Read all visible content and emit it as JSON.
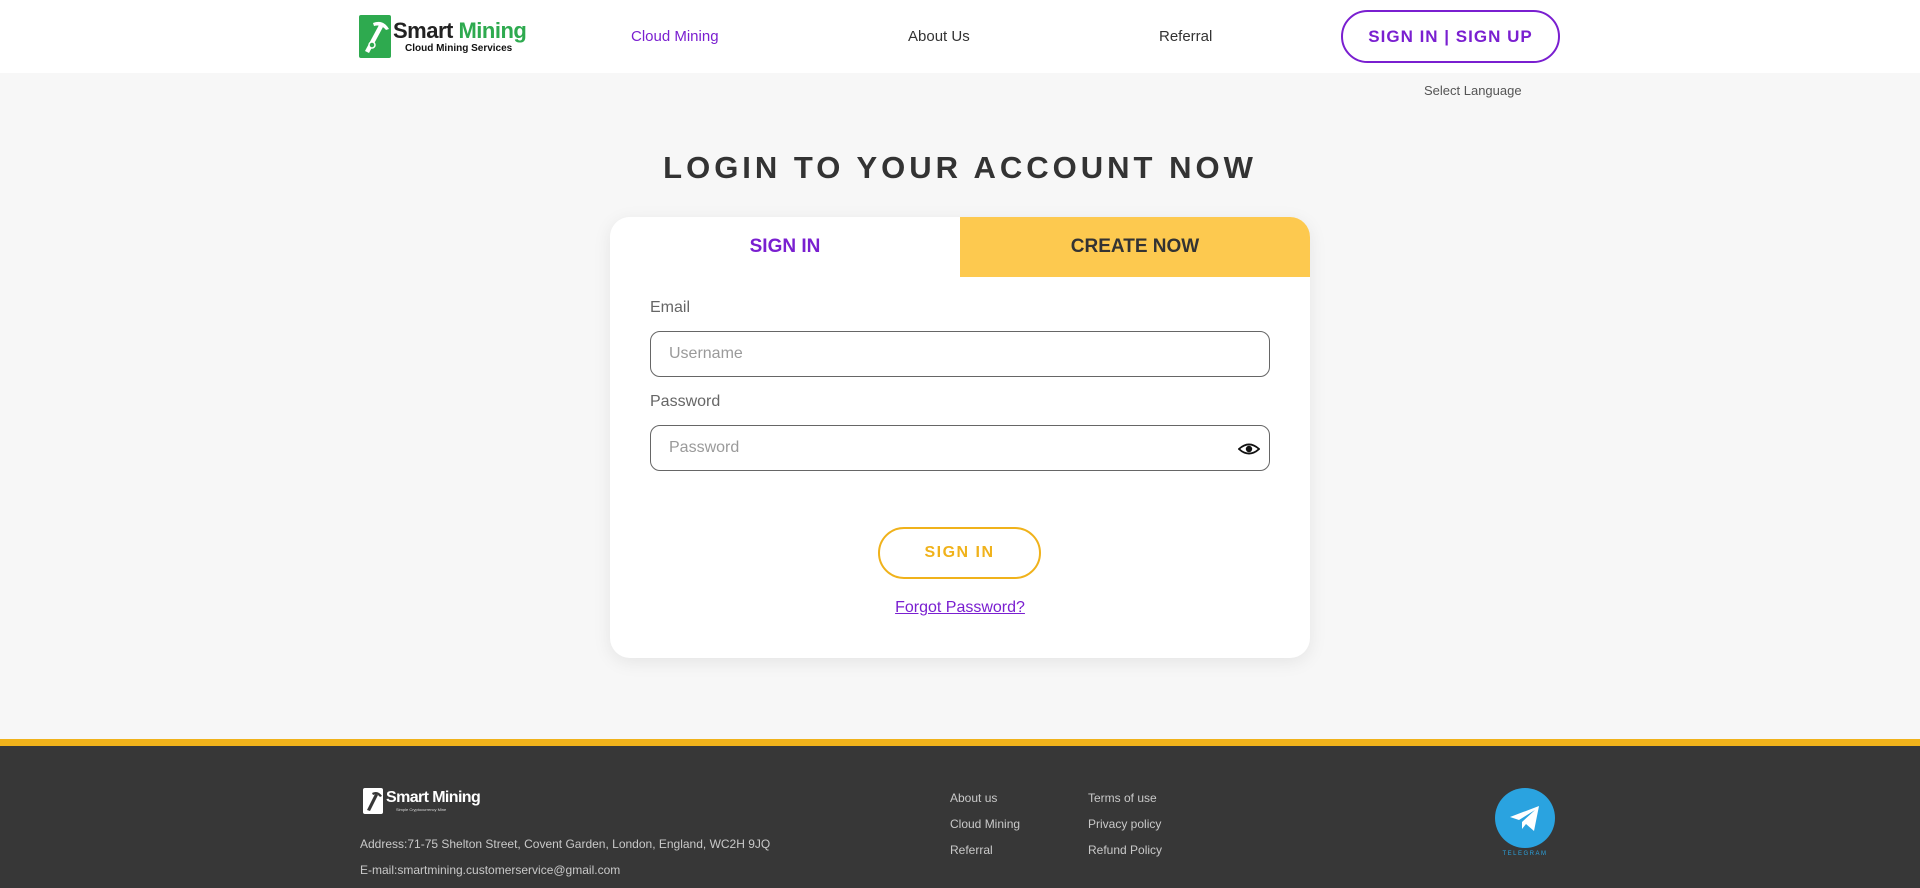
{
  "header": {
    "logo_title_1": "Smart",
    "logo_title_2": "Mining",
    "logo_subtitle": "Cloud Mining Services",
    "nav": [
      {
        "label": "Cloud Mining"
      },
      {
        "label": "About Us"
      },
      {
        "label": "Referral"
      }
    ],
    "auth_button": "SIGN IN | SIGN UP",
    "language": "Select Language"
  },
  "main": {
    "title": "LOGIN TO YOUR ACCOUNT NOW",
    "tabs": [
      {
        "label": "SIGN IN"
      },
      {
        "label": "CREATE NOW"
      }
    ],
    "email_label": "Email",
    "email_placeholder": "Username",
    "password_label": "Password",
    "password_placeholder": "Password",
    "submit_label": "SIGN IN",
    "forgot_label": "Forgot Password?"
  },
  "footer": {
    "logo_title": "Smart Mining",
    "logo_subtitle": "Simple Cryptocurrency Mine",
    "address": "Address:71-75 Shelton Street, Covent Garden, London, England, WC2H 9JQ",
    "email": "E-mail:smartmining.customerservice@gmail.com",
    "links_col1": [
      {
        "label": "About us"
      },
      {
        "label": "Cloud Mining"
      },
      {
        "label": "Referral"
      }
    ],
    "links_col2": [
      {
        "label": "Terms of use"
      },
      {
        "label": "Privacy policy"
      },
      {
        "label": "Refund Policy"
      }
    ],
    "telegram_label": "TELEGRAM"
  },
  "colors": {
    "accent_purple": "#7a1fd0",
    "accent_yellow": "#f0b21b",
    "tab_yellow": "#fdc94f",
    "brand_green": "#2eaa4f",
    "footer_bg": "#373737",
    "telegram_blue": "#2aa3e0"
  },
  "icons": [
    "pickaxe-logo-icon",
    "eye-icon",
    "telegram-icon"
  ]
}
